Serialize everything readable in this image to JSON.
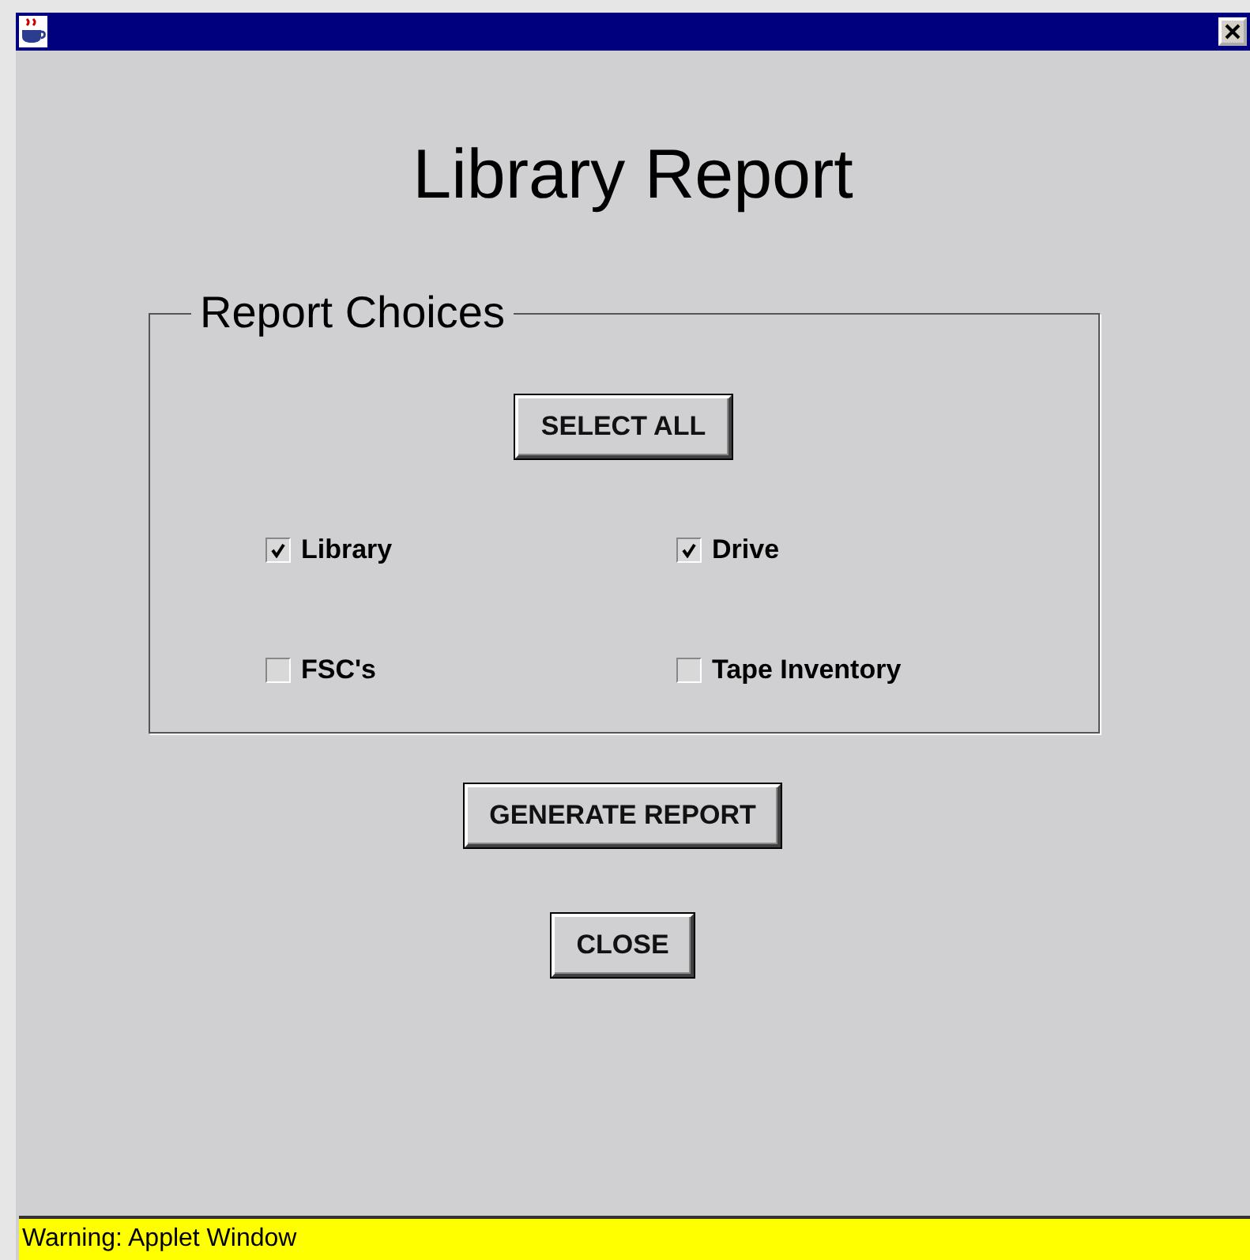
{
  "heading": "Library Report",
  "group": {
    "legend": "Report Choices",
    "select_all": "SELECT ALL",
    "options": [
      {
        "label": "Library",
        "checked": true
      },
      {
        "label": "Drive",
        "checked": true
      },
      {
        "label": "FSC's",
        "checked": false
      },
      {
        "label": "Tape Inventory",
        "checked": false
      }
    ]
  },
  "buttons": [
    "GENERATE REPORT",
    "CLOSE"
  ],
  "status_bar": "Warning: Applet Window"
}
